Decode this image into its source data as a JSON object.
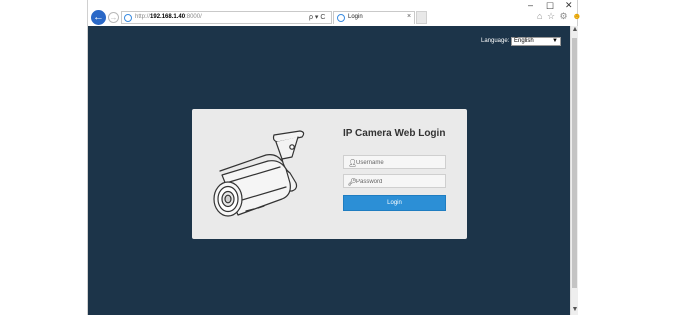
{
  "window": {
    "min_glyph": "–",
    "max_glyph": "☐",
    "close_glyph": "✕"
  },
  "nav": {
    "back_glyph": "←",
    "forward_glyph": "→"
  },
  "address_bar": {
    "url_prefix": "http://",
    "url_host": "192.168.1.40",
    "url_suffix": ":8000/",
    "tools": "ρ ▾ C"
  },
  "tab": {
    "title": "Login",
    "close_glyph": "×"
  },
  "toolbar_icons": {
    "home": "⌂",
    "favorites": "☆",
    "settings": "⚙",
    "feedback": "☻"
  },
  "page": {
    "background": "#1c3449",
    "language": {
      "label": "Language:",
      "selected": "English"
    },
    "login": {
      "title": "IP Camera Web Login",
      "username_placeholder": "Username",
      "password_placeholder": "Password",
      "button_label": "Login",
      "accent": "#2c8fd6"
    }
  },
  "icons": {
    "user": "user-icon",
    "password": "key-icon",
    "camera": "camera-illustration"
  }
}
